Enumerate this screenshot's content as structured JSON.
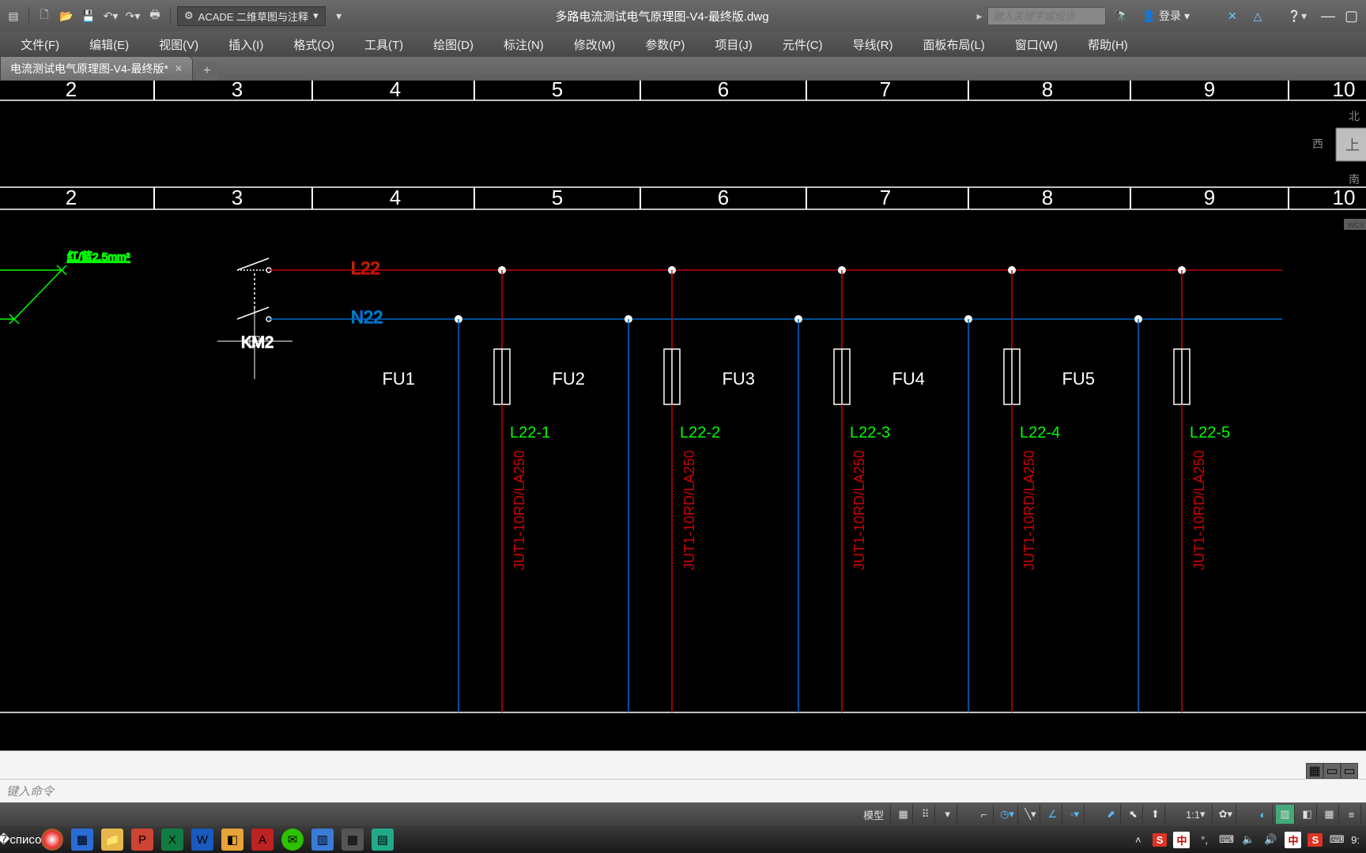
{
  "titlebar": {
    "workspace": "ACADE 二维草图与注释",
    "doc_title": "多路电流测试电气原理图-V4-最终版.dwg",
    "search_placeholder": "键入关键字或短语",
    "login": "登录"
  },
  "menubar": {
    "items": [
      "文件(F)",
      "编辑(E)",
      "视图(V)",
      "插入(I)",
      "格式(O)",
      "工具(T)",
      "绘图(D)",
      "标注(N)",
      "修改(M)",
      "参数(P)",
      "项目(J)",
      "元件(C)",
      "导线(R)",
      "面板布局(L)",
      "窗口(W)",
      "帮助(H)"
    ]
  },
  "docTabs": {
    "active": "电流测试电气原理图-V4-最终版*"
  },
  "rulers": {
    "top1": [
      "2",
      "3",
      "4",
      "5",
      "6",
      "7",
      "8",
      "9",
      "10"
    ],
    "top2": [
      "2",
      "3",
      "4",
      "5",
      "6",
      "7",
      "8",
      "9",
      "10"
    ]
  },
  "drawing": {
    "wire_note": "红/蓝2.5mm²",
    "line_L": "L22",
    "line_N": "N22",
    "switch_label": "KM2",
    "fuses": [
      "FU1",
      "FU2",
      "FU3",
      "FU4",
      "FU5"
    ],
    "branches": [
      "L22-1",
      "L22-2",
      "L22-3",
      "L22-4",
      "L22-5"
    ],
    "fuse_type": "JUT1-10RD/LA250"
  },
  "viewcube": {
    "n": "北",
    "w": "西",
    "s": "南",
    "top": "上",
    "wcs": "WCS"
  },
  "cmd": {
    "prompt": "键入命令"
  },
  "statusbar": {
    "model": "模型",
    "scale": "1:1"
  },
  "tray": {
    "clock": "9:",
    "lang": "中"
  }
}
